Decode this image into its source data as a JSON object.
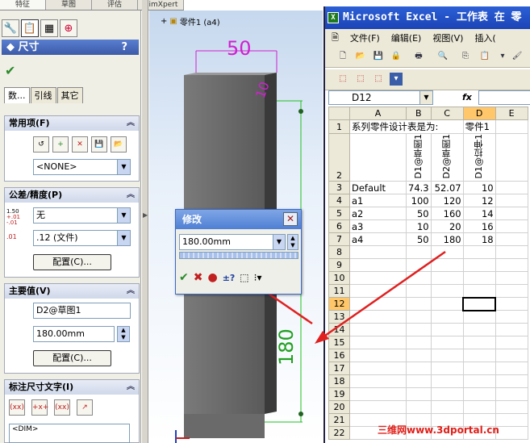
{
  "toptabs": [
    "特征",
    "草图",
    "评估",
    "DimXpert"
  ],
  "pm": {
    "title": "尺寸",
    "help": "?",
    "subtabs": [
      "数...",
      "引线",
      "其它"
    ],
    "groups": {
      "common": {
        "label": "常用项(F)",
        "select_value": "<NONE>"
      },
      "tolerance": {
        "label": "公差/精度(P)",
        "tol_value": "无",
        "prec_value": ".12 (文件)",
        "config_button": "配置(C)..."
      },
      "primary": {
        "label": "主要值(V)",
        "name_value": "D2@草图1",
        "dim_value": "180.00mm",
        "config_button": "配置(C)..."
      },
      "dimtext": {
        "label": "标注尺寸文字(I)",
        "text_value": "<DIM>"
      }
    },
    "icons": {
      "tol": "1.50",
      "tol_sup": "+.01",
      "tol_sub": "-.01",
      "prec": ".01"
    }
  },
  "viewport": {
    "part_label": "零件1 (a4)",
    "dim_top": "50",
    "dim_side": "10",
    "dim_height": "180"
  },
  "dialog": {
    "title": "修改",
    "value": "180.00mm"
  },
  "excel": {
    "title": "Microsoft Excel - 工作表 在 零",
    "menu": [
      "文件(F)",
      "编辑(E)",
      "视图(V)",
      "插入("
    ],
    "namebox": "D12",
    "fx": "fx",
    "columns": [
      "A",
      "B",
      "C",
      "D",
      "E"
    ],
    "row1": {
      "a": "系列零件设计表是为:",
      "d": "零件1"
    },
    "headers": {
      "b": "D1@草图1",
      "c": "D2@草图1",
      "d": "D1@拉伸1"
    },
    "rows": [
      {
        "n": "3",
        "a": "Default",
        "b": "74.3",
        "c": "52.07",
        "d": "10"
      },
      {
        "n": "4",
        "a": "a1",
        "b": "100",
        "c": "120",
        "d": "12"
      },
      {
        "n": "5",
        "a": "a2",
        "b": "50",
        "c": "160",
        "d": "14"
      },
      {
        "n": "6",
        "a": "a3",
        "b": "10",
        "c": "20",
        "d": "16"
      },
      {
        "n": "7",
        "a": "a4",
        "b": "50",
        "c": "180",
        "d": "18"
      }
    ],
    "empty_rows": [
      "8",
      "9",
      "10",
      "11",
      "12",
      "13",
      "14",
      "15",
      "16",
      "17",
      "18",
      "19",
      "20",
      "21",
      "22"
    ]
  },
  "watermark": "三维网www.3dportal.cn"
}
